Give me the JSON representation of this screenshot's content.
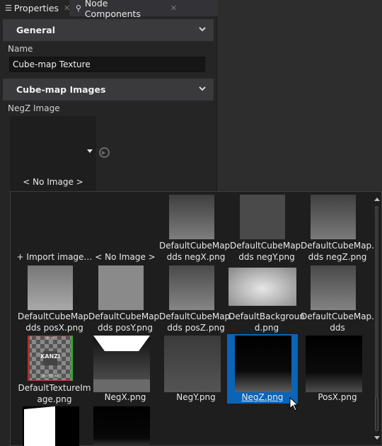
{
  "tabs": [
    {
      "label": "Properties",
      "icon": "list-icon",
      "active": true
    },
    {
      "label": "Node Components",
      "icon": "components-icon",
      "active": false
    }
  ],
  "sections": {
    "general": "General",
    "cubemap_images": "Cube-map Images"
  },
  "fields": {
    "name_label": "Name",
    "name_value": "Cube-map Texture",
    "negz_label": "NegZ Image",
    "negz_value": "< No Image >"
  },
  "picker": {
    "items": [
      {
        "caption": "+ Import image…",
        "thumb": "none"
      },
      {
        "caption": "< No Image >",
        "thumb": "none"
      },
      {
        "caption": "DefaultCubeMap.\ndds negX.png",
        "thumb": "gradient"
      },
      {
        "caption": "DefaultCubeMap.\ndds negY.png",
        "thumb": "flat"
      },
      {
        "caption": "DefaultCubeMap.\ndds negZ.png",
        "thumb": "gradient"
      },
      {
        "caption": "DefaultCubeMap.\ndds posX.png",
        "thumb": "gradient"
      },
      {
        "caption": "DefaultCubeMap.\ndds posY.png",
        "thumb": "flat"
      },
      {
        "caption": "DefaultCubeMap.\ndds posZ.png",
        "thumb": "gradient"
      },
      {
        "caption": "DefaultBackgroun\nd.png",
        "thumb": "background"
      },
      {
        "caption": "DefaultCubeMap.\ndds",
        "thumb": "gradient"
      },
      {
        "caption": "DefaultTextureIm\nage.png",
        "thumb": "checker"
      },
      {
        "caption": "NegX.png",
        "thumb": "negx"
      },
      {
        "caption": "NegY.png",
        "thumb": "negy"
      },
      {
        "caption": "NegZ.png",
        "thumb": "negz",
        "selected": true
      },
      {
        "caption": "PosX.png",
        "thumb": "posx"
      }
    ],
    "checker_lettering": {
      "top": "TOP",
      "center": "KANZI",
      "bottom": "BOTTOM"
    }
  },
  "colors": {
    "selection": "#0a64b8",
    "panel_bg": "#252526",
    "section_bg": "#3a3a3c"
  }
}
